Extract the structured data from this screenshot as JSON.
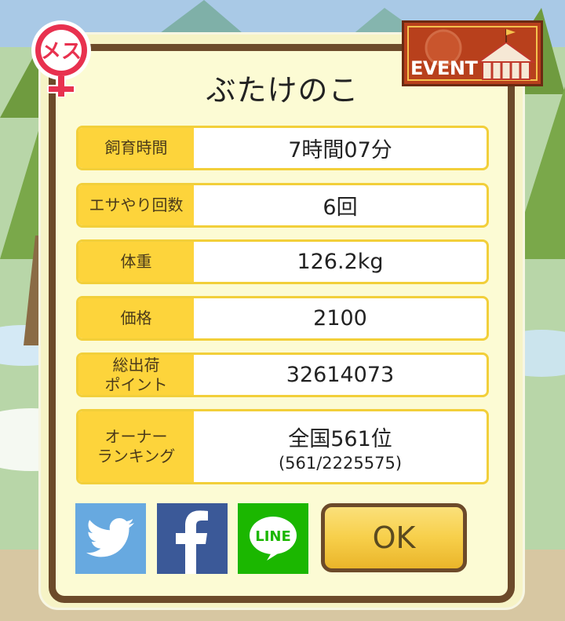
{
  "title": "ぶたけのこ",
  "gender_badge": {
    "text": "メス"
  },
  "event_badge": {
    "text": "EVENT"
  },
  "stats": [
    {
      "label": "飼育時間",
      "value": "7時間07分"
    },
    {
      "label": "エサやり回数",
      "value": "6回"
    },
    {
      "label": "体重",
      "value": "126.2kg"
    },
    {
      "label": "価格",
      "value": "2100"
    },
    {
      "label": "総出荷\nポイント",
      "value": "32614073"
    },
    {
      "label": "オーナー\nランキング",
      "value": "全国561位",
      "sub": "(561/2225575)"
    }
  ],
  "share": {
    "twitter": {
      "icon": "twitter-bird-icon",
      "color": "#67a9e0"
    },
    "facebook": {
      "icon": "facebook-f-icon",
      "color": "#3b5998"
    },
    "line": {
      "text": "LINE",
      "color": "#1bb700"
    }
  },
  "ok_label": "OK",
  "colors": {
    "panel_border": "#6c4a2a",
    "panel_fill": "#fcfbd4",
    "label_fill": "#fdd43b",
    "ok_fill": "#f7cf4a"
  }
}
